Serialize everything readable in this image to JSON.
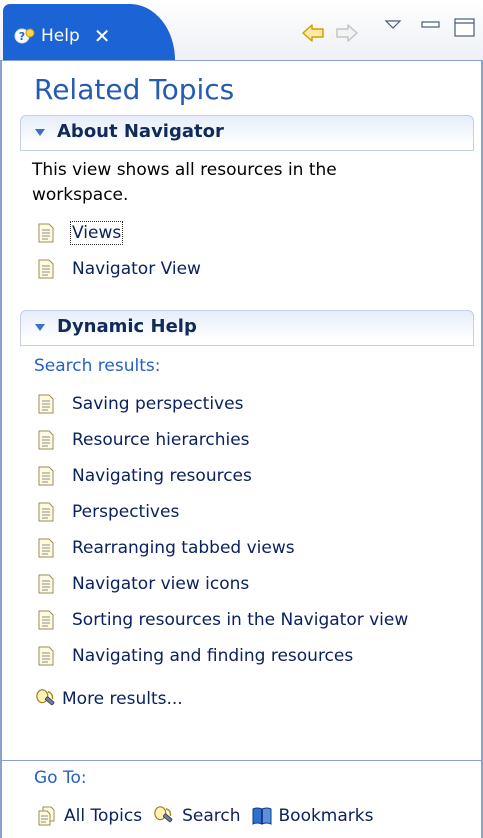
{
  "tab": {
    "label": "Help",
    "close": "✕"
  },
  "title": "Related Topics",
  "about": {
    "header": "About Navigator",
    "description": "This view shows all resources in the workspace.",
    "links": [
      "Views",
      "Navigator View"
    ]
  },
  "dynamic": {
    "header": "Dynamic Help",
    "search_label": "Search results:",
    "results": [
      "Saving perspectives",
      "Resource hierarchies",
      "Navigating resources",
      "Perspectives",
      "Rearranging tabbed views",
      "Navigator view icons",
      "Sorting resources in the Navigator view",
      "Navigating and finding resources"
    ],
    "more": "More results..."
  },
  "goto": {
    "label": "Go To:",
    "all_topics": "All Topics",
    "search": "Search",
    "bookmarks": "Bookmarks"
  },
  "colors": {
    "tab": "#1c63d5",
    "title": "#255bb3",
    "link": "#0b2260",
    "border": "#8aa1d0"
  }
}
